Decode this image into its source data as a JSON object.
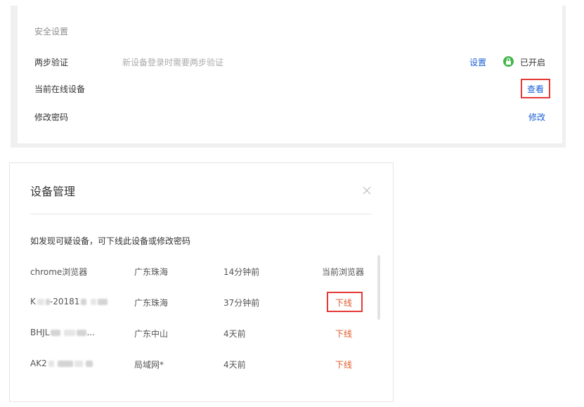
{
  "security": {
    "title": "安全设置",
    "two_step": {
      "label": "两步验证",
      "desc": "新设备登录时需要两步验证",
      "setting_link": "设置",
      "status": "已开启",
      "status_icon": "lock-icon",
      "status_color": "#44b549"
    },
    "online_devices": {
      "label": "当前在线设备",
      "action": "查看"
    },
    "change_password": {
      "label": "修改密码",
      "action": "修改"
    }
  },
  "dialog": {
    "title": "设备管理",
    "hint": "如发现可疑设备，可下线此设备或修改密码",
    "devices": [
      {
        "name": "chrome浏览器",
        "location": "广东珠海",
        "time": "14分钟前",
        "state": "当前浏览器"
      },
      {
        "name_prefix": "K",
        "name_visible": "-20181",
        "location": "广东珠海",
        "time": "37分钟前",
        "action": "下线"
      },
      {
        "name_prefix": "BHJL",
        "name_suffix": "...",
        "location": "广东中山",
        "time": "4天前",
        "action": "下线"
      },
      {
        "name_prefix": "AK2",
        "location": "局域网*",
        "time": "4天前",
        "action": "下线"
      }
    ]
  },
  "colors": {
    "link": "#1a5fd6",
    "offline": "#e05a2a",
    "highlight_box": "#e53935"
  }
}
